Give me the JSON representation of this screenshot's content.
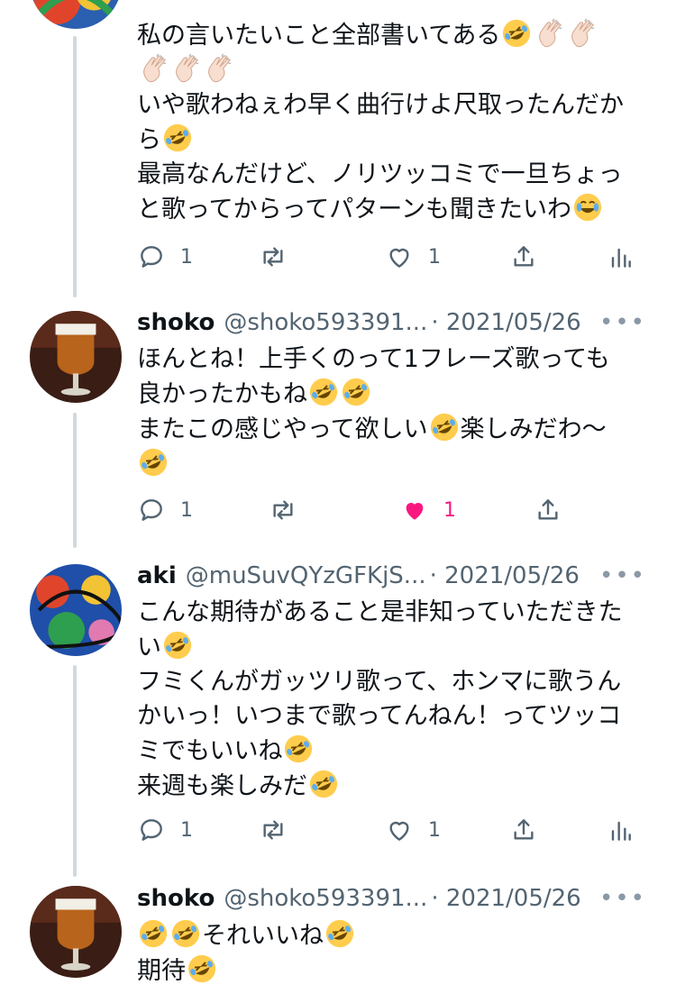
{
  "tweets": [
    {
      "id": "t0",
      "header_partial": "",
      "lines": [
        "私の言いたいこと全部書いてある🤣👏🏻👏🏻",
        "👏🏻👏🏻👏🏻",
        "いや歌わねぇわ早く曲行けよ尺取ったんだか",
        "ら🤣",
        "最高なんだけど、ノリツッコミで一旦ちょっ",
        "と歌ってからってパターンも聞きたいわ😂"
      ],
      "reply_count": "1",
      "like_count": "1",
      "liked": false
    },
    {
      "id": "t1",
      "name": "shoko",
      "handle": "@shoko593391...",
      "date": "· 2021/05/26",
      "lines": [
        "ほんとね！上手くのって1フレーズ歌っても",
        "良かったかもね🤣🤣",
        "またこの感じやって欲しい🤣楽しみだわ〜",
        "🤣"
      ],
      "reply_count": "1",
      "like_count": "1",
      "liked": true
    },
    {
      "id": "t2",
      "name": "aki",
      "handle": "@muSuvQYzGFKjS...",
      "date": "· 2021/05/26",
      "lines": [
        "こんな期待があること是非知っていただきた",
        "い🤣",
        "フミくんがガッツリ歌って、ホンマに歌うん",
        "かいっ！いつまで歌ってんねん！ってツッコ",
        "ミでもいいね🤣",
        "来週も楽しみだ🤣"
      ],
      "reply_count": "1",
      "like_count": "1",
      "liked": false
    },
    {
      "id": "t3",
      "name": "shoko",
      "handle": "@shoko593391...",
      "date": "· 2021/05/26",
      "lines": [
        "🤣🤣それいいね🤣",
        "期待🤣"
      ]
    }
  ],
  "icons": {
    "reply": "reply-icon",
    "retweet": "retweet-icon",
    "like": "like-icon",
    "share": "share-icon",
    "analytics": "analytics-icon",
    "more": "more-icon"
  },
  "colors": {
    "like_active": "#f91880",
    "muted": "#536471",
    "thread_line": "#cfd9de"
  }
}
